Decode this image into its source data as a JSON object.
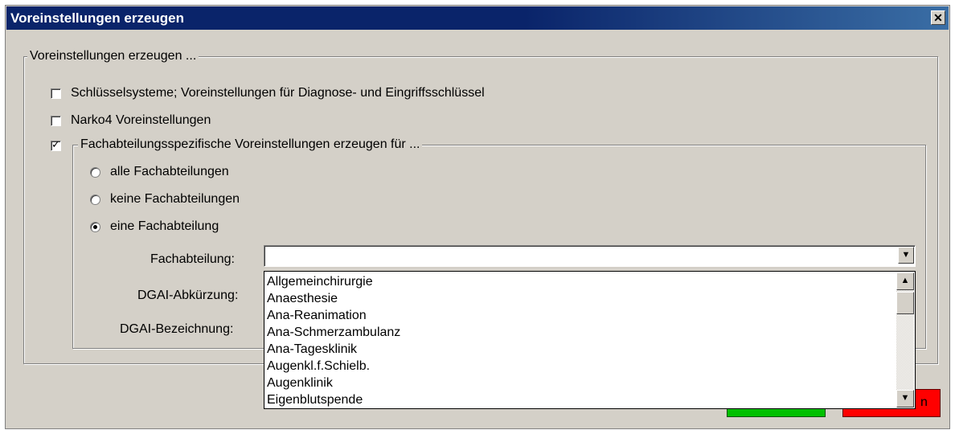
{
  "window": {
    "title": "Voreinstellungen erzeugen",
    "close_glyph": "✕"
  },
  "outer_group": {
    "legend": "Voreinstellungen erzeugen ..."
  },
  "options": {
    "schluessel_label": "Schlüsselsysteme; Voreinstellungen für Diagnose- und Eingriffsschlüssel",
    "schluessel_checked": false,
    "narko_label": "Narko4 Voreinstellungen",
    "narko_checked": false,
    "fachabt_label": "Fachabteilungsspezifische Voreinstellungen erzeugen für ...",
    "fachabt_checked": true,
    "check_glyph": "✓"
  },
  "radios": {
    "alle": "alle Fachabteilungen",
    "keine": "keine Fachabteilungen",
    "eine": "eine Fachabteilung",
    "selected": "eine"
  },
  "fields": {
    "fachabteilung_label": "Fachabteilung:",
    "fachabteilung_value": "",
    "dgai_abk_label": "DGAI-Abkürzung:",
    "dgai_bez_label": "DGAI-Bezeichnung:"
  },
  "dropdown": {
    "items": [
      "Allgemeinchirurgie",
      "Anaesthesie",
      "Ana-Reanimation",
      "Ana-Schmerzambulanz",
      "Ana-Tagesklinik",
      "Augenkl.f.Schielb.",
      "Augenklinik",
      "Eigenblutspende"
    ]
  },
  "icons": {
    "combo_arrow": "▼",
    "scroll_up": "▲",
    "scroll_down": "▼"
  },
  "buttons": {
    "red_partial_label": "n"
  },
  "colors": {
    "title_bg": "#0a246a",
    "window_bg": "#d4d0c8",
    "ok_green": "#00c000",
    "cancel_red": "#ff0000"
  }
}
